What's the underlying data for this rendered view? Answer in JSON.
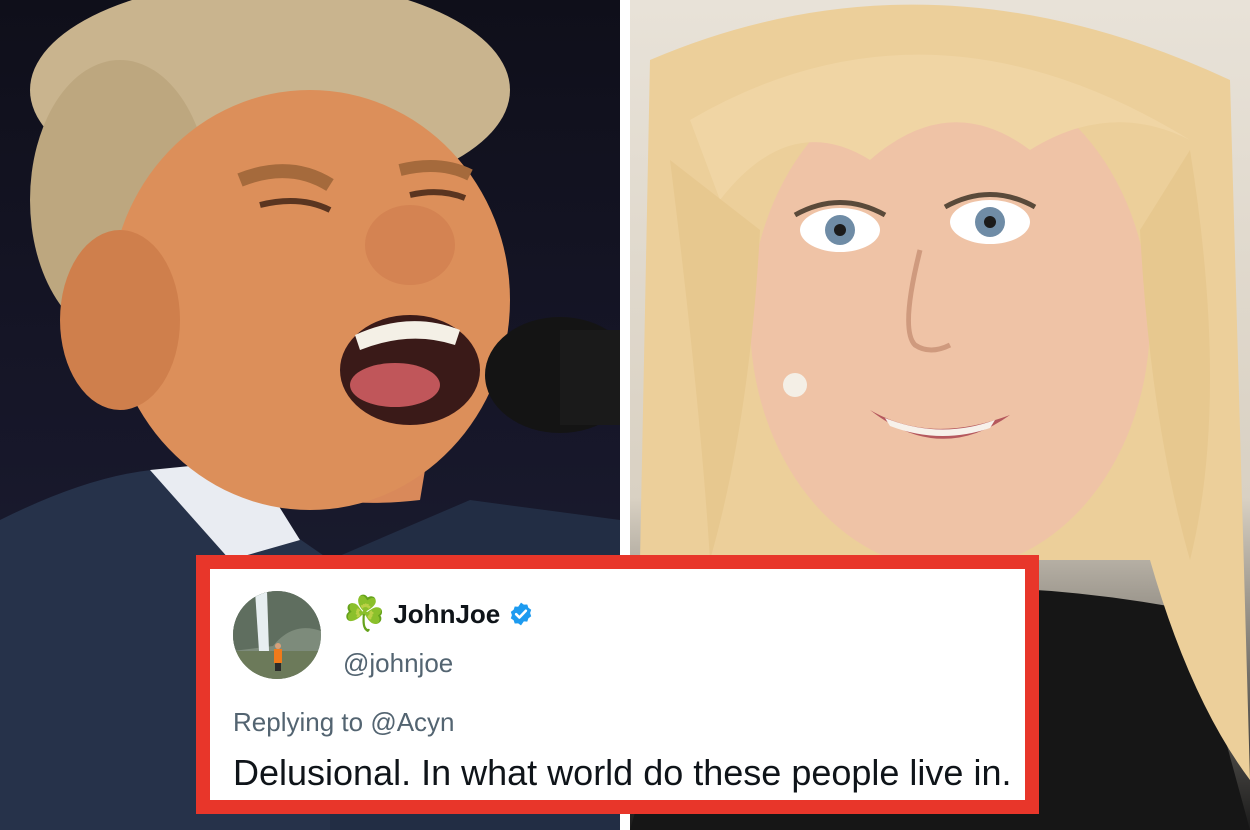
{
  "tweet": {
    "display_name": "JohnJoe",
    "name_emoji": "☘️",
    "handle": "@johnjoe",
    "reply_prefix": "Replying to",
    "reply_to": "@Acyn",
    "text": "Delusional. In what world do these people live in."
  },
  "icons": {
    "verified": "verified-badge-icon",
    "emoji": "shamrock-icon"
  },
  "colors": {
    "card_border": "#e8362a",
    "verified_blue": "#1d9bf0",
    "text_primary": "#0f1419",
    "text_secondary": "#536471"
  }
}
